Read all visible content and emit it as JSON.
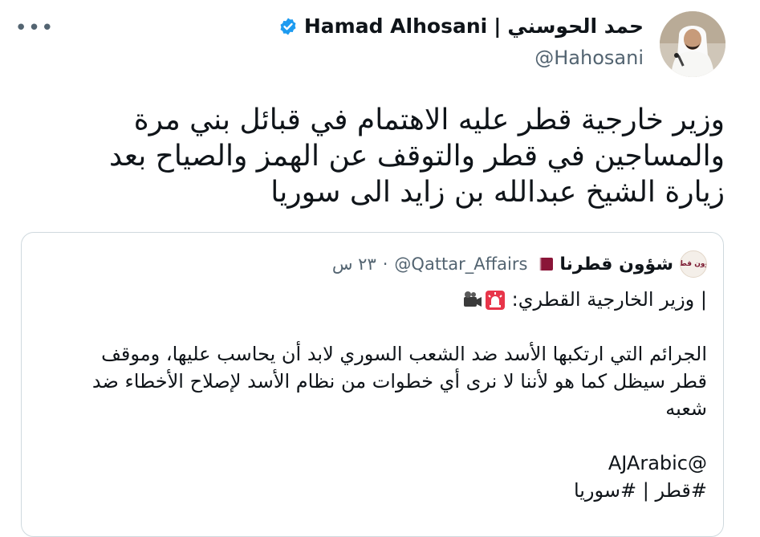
{
  "author": {
    "display_name_en": "Hamad Alhosani",
    "separator": "|",
    "display_name_ar": "حمد الحوسني",
    "handle": "@Hahosani",
    "verified_color": "#1d9bf0"
  },
  "menu": {
    "more_label": "•••"
  },
  "tweet": {
    "text_lines": [
      "وزير خارجية قطر عليه الاهتمام في قبائل بني مرة",
      "والمساجين في قطر والتوقف عن الهمز والصياح بعد",
      "زيارة الشيخ عبدالله بن زايد الى سوريا"
    ]
  },
  "quoted": {
    "avatar_text": "شؤون قطرنا",
    "display_name": "شؤون قطرنا",
    "flag_color": "#8a1538",
    "handle": "@Qattar_Affairs",
    "dot": "·",
    "time": "٢٣ س",
    "emojis": [
      "camera-icon",
      "siren-icon"
    ],
    "line1_text": "| وزير الخارجية القطري:",
    "line2": "الجرائم التي ارتكبها الأسد ضد الشعب السوري لابد أن يحاسب عليها، وموقف",
    "line3": "قطر سيظل كما هو لأننا لا نرى أي خطوات من نظام الأسد لإصلاح الأخطاء ضد",
    "line4": "شعبه",
    "mention": "@AJArabic",
    "hashtags": "#قطر | #سوريا"
  }
}
